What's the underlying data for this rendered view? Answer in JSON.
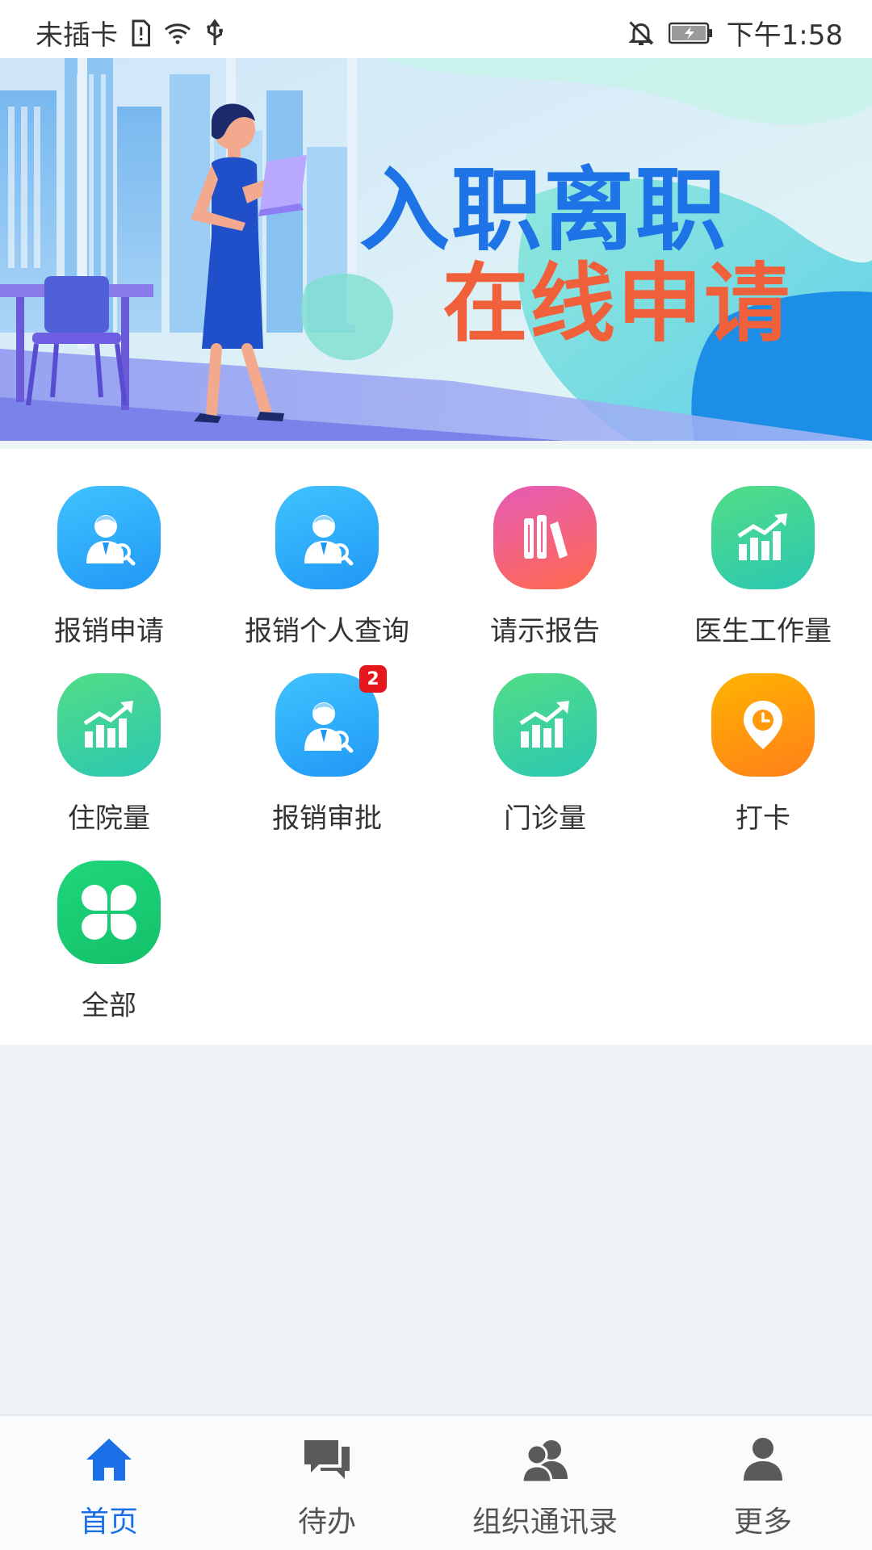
{
  "status_bar": {
    "carrier": "未插卡",
    "time": "下午1:58",
    "icons": [
      "sim-alert-icon",
      "wifi-icon",
      "usb-icon",
      "mute-icon",
      "battery-charging-icon"
    ]
  },
  "banner": {
    "line1": "入职离职",
    "line2": "在线申请"
  },
  "grid": {
    "items": [
      {
        "label": "报销申请",
        "icon": "user-search-icon",
        "color": "#2aa9f8"
      },
      {
        "label": "报销个人查询",
        "icon": "user-search-icon",
        "color": "#2aa9f8"
      },
      {
        "label": "请示报告",
        "icon": "books-icon",
        "color": "#f06086"
      },
      {
        "label": "医生工作量",
        "icon": "growth-chart-icon",
        "color": "#3cd39c"
      },
      {
        "label": "住院量",
        "icon": "growth-chart-icon",
        "color": "#3cd39c"
      },
      {
        "label": "报销审批",
        "icon": "user-search-icon",
        "color": "#2aa9f8",
        "badge": "2"
      },
      {
        "label": "门诊量",
        "icon": "growth-chart-icon",
        "color": "#3cd39c"
      },
      {
        "label": "打卡",
        "icon": "location-clock-icon",
        "color": "#ff9a0d"
      },
      {
        "label": "全部",
        "icon": "clover-icon",
        "color": "#1ccf74"
      }
    ]
  },
  "bottom_nav": {
    "items": [
      {
        "label": "首页",
        "icon": "home-icon",
        "active": true
      },
      {
        "label": "待办",
        "icon": "chat-icon",
        "active": false
      },
      {
        "label": "组织通讯录",
        "icon": "contacts-icon",
        "active": false
      },
      {
        "label": "更多",
        "icon": "person-icon",
        "active": false
      }
    ],
    "active_color": "#1a6fe6"
  }
}
